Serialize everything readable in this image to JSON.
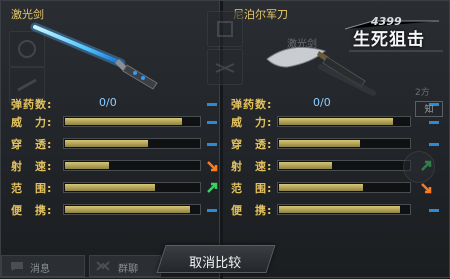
{
  "left": {
    "weapon_name": "激光剑",
    "stats": [
      {
        "label": "弹药数:",
        "ammo": "0/0",
        "indicator": "dash"
      },
      {
        "label": "威　力:",
        "value": 0.88,
        "indicator": "dash"
      },
      {
        "label": "穿　透:",
        "value": 0.62,
        "indicator": "dash"
      },
      {
        "label": "射　速:",
        "value": 0.34,
        "indicator": "down-icon"
      },
      {
        "label": "范　围:",
        "value": 0.68,
        "indicator": "up-icon"
      },
      {
        "label": "便　携:",
        "value": 0.94,
        "indicator": "dash"
      }
    ]
  },
  "right": {
    "weapon_name": "尼泊尔军刀",
    "ghost_label": "激光剑",
    "stats": [
      {
        "label": "弹药数:",
        "ammo": "0/0",
        "indicator": "dash"
      },
      {
        "label": "威　力:",
        "value": 0.88,
        "indicator": "dash"
      },
      {
        "label": "穿　透:",
        "value": 0.62,
        "indicator": "dash"
      },
      {
        "label": "射　速:",
        "value": 0.42,
        "indicator": "up-icon"
      },
      {
        "label": "范　围:",
        "value": 0.66,
        "indicator": "down-icon"
      },
      {
        "label": "便　携:",
        "value": 0.94,
        "indicator": "dash"
      }
    ]
  },
  "logo": {
    "number": "4399",
    "title": "生死狙击"
  },
  "bottom": {
    "cancel_compare": "取消比较",
    "tab1": "消息",
    "tab2": "群聊"
  },
  "side_labels": {
    "top_right": "2方",
    "mid_right": "知"
  },
  "colors": {
    "label": "#e3c25e",
    "bar": "#c8b866",
    "ammo": "#8fd0ff",
    "up": "#3cd060",
    "down": "#ff7a1a",
    "dash": "#2a8ad6"
  }
}
